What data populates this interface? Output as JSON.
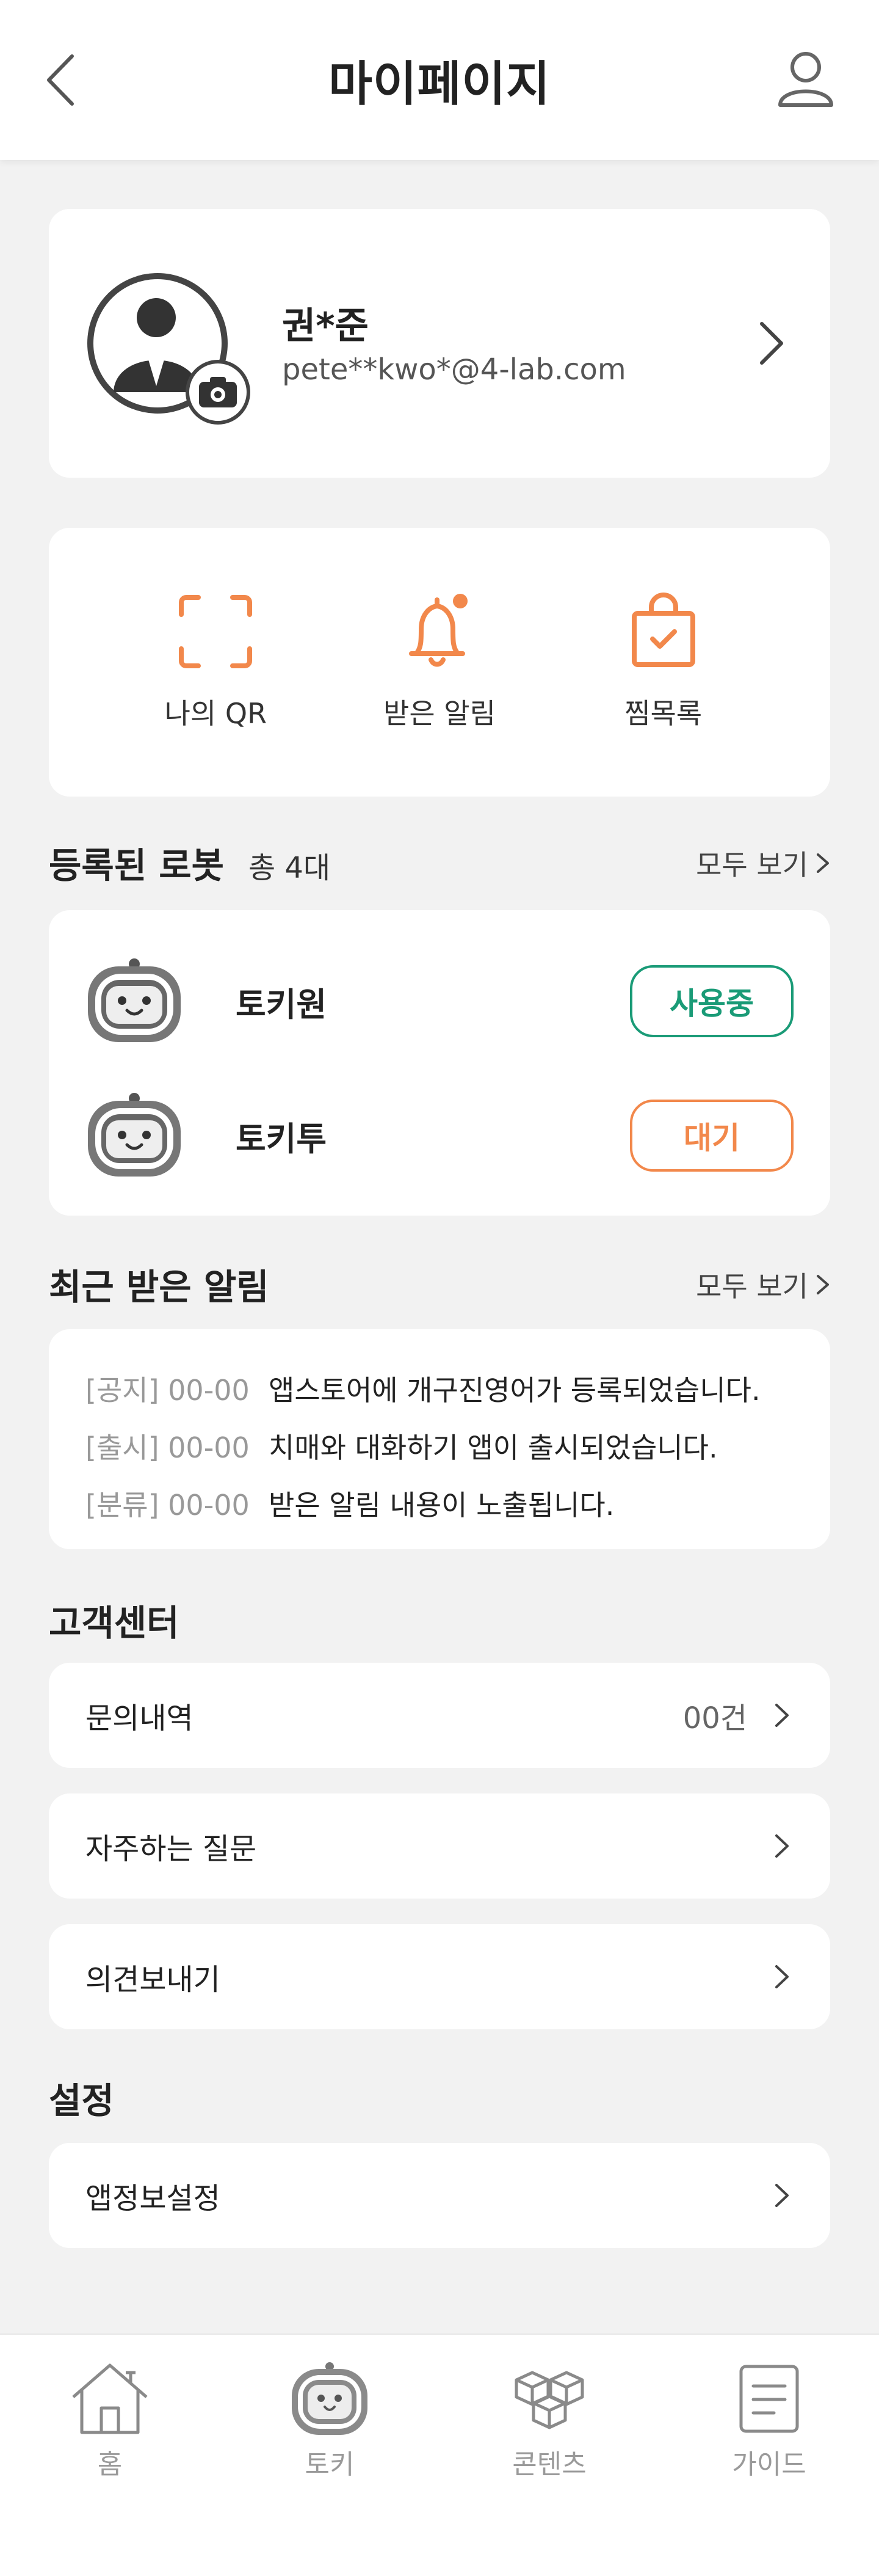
{
  "header": {
    "title": "마이페이지",
    "back_icon": "chevron-left-icon",
    "profile_icon": "user-icon"
  },
  "profile": {
    "name": "권*준",
    "email": "pete**kwo*@4-lab.com"
  },
  "quick_menu": [
    {
      "label": "나의 QR",
      "icon": "qr-scan-icon"
    },
    {
      "label": "받은 알림",
      "icon": "bell-icon"
    },
    {
      "label": "찜목록",
      "icon": "shopping-bag-check-icon"
    }
  ],
  "robots_section": {
    "title": "등록된 로봇",
    "count": "총 4대",
    "see_all": "모두 보기"
  },
  "robots": [
    {
      "name": "토키원",
      "status": "사용중"
    },
    {
      "name": "토키투",
      "status": "대기"
    }
  ],
  "notices_section": {
    "title": "최근 받은 알림",
    "see_all": "모두 보기"
  },
  "notices": [
    {
      "tag": "[공지] 00-00",
      "text": "앱스토어에 개구진영어가 등록되었습니다."
    },
    {
      "tag": "[출시] 00-00",
      "text": "치매와 대화하기 앱이 출시되었습니다."
    },
    {
      "tag": "[분류] 00-00",
      "text": "받은 알림 내용이 노출됩니다."
    }
  ],
  "support": {
    "title": "고객센터",
    "items": [
      {
        "label": "문의내역",
        "count": "00건"
      },
      {
        "label": "자주하는 질문"
      },
      {
        "label": "의견보내기"
      }
    ]
  },
  "settings": {
    "title": "설정",
    "items": [
      {
        "label": "앱정보설정"
      }
    ]
  },
  "tabbar": [
    {
      "label": "홈"
    },
    {
      "label": "토키"
    },
    {
      "label": "콘텐츠"
    },
    {
      "label": "가이드"
    }
  ],
  "colors": {
    "accent_orange": "#f2884b",
    "active_green": "#1a9b77",
    "background": "#f2f2f2"
  }
}
